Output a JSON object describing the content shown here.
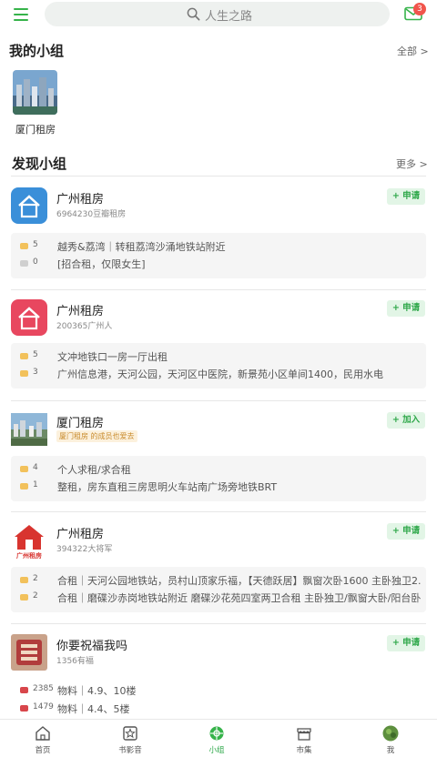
{
  "header": {
    "search_placeholder": "人生之路",
    "mail_badge": "3"
  },
  "my_groups": {
    "title": "我的小组",
    "all_label": "全部 >",
    "items": [
      {
        "label": "厦门租房"
      }
    ]
  },
  "discover": {
    "title": "发现小组",
    "more_label": "更多 >",
    "groups": [
      {
        "name": "广州租房",
        "sub": "6964230豆瓣租房",
        "button": "+ 申请",
        "posts": [
          {
            "count": "5",
            "text": "越秀&荔湾｜转租荔湾沙涌地铁站附近"
          },
          {
            "count": "0",
            "text": "[招合租，仅限女生]"
          }
        ]
      },
      {
        "name": "广州租房",
        "sub": "200365广州人",
        "button": "+ 申请",
        "posts": [
          {
            "count": "5",
            "text": "文冲地铁口一房一厅出租"
          },
          {
            "count": "3",
            "text": "广州信息港，天河公园，天河区中医院，新景苑小区单间1400，民用水电"
          }
        ]
      },
      {
        "name": "厦门租房",
        "tag": "厦门租房 的成员也爱去",
        "button": "+ 加入",
        "posts": [
          {
            "count": "4",
            "text": "个人求租/求合租"
          },
          {
            "count": "1",
            "text": "整租，房东直租三房思明火车站南广场旁地铁BRT"
          }
        ]
      },
      {
        "name": "广州租房",
        "sub": "394322大将军",
        "button": "+ 申请",
        "icon_text": "广州租房",
        "posts": [
          {
            "count": "2",
            "text": "合租｜天河公园地铁站，员村山顶家乐福，【天德跃居】飘窗次卧1600 主卧独卫2..."
          },
          {
            "count": "2",
            "text": "合租｜磨碟沙赤岗地铁站附近 磨碟沙花苑四室两卫合租 主卧独卫/飘窗大卧/阳台卧..."
          }
        ]
      },
      {
        "name": "你要祝福我吗",
        "sub": "1356有福",
        "button": "+ 申请",
        "posts": [
          {
            "count": "2385",
            "text": "物料｜4.9、10楼"
          },
          {
            "count": "1479",
            "text": "物料｜4.4、5楼"
          }
        ]
      }
    ]
  },
  "nav": {
    "items": [
      {
        "label": "首页"
      },
      {
        "label": "书影音"
      },
      {
        "label": "小组"
      },
      {
        "label": "市集"
      },
      {
        "label": "我"
      }
    ],
    "active_color": "#2fa84a"
  },
  "colors": {
    "accent": "#36b34a",
    "badge": "#f1554c"
  }
}
